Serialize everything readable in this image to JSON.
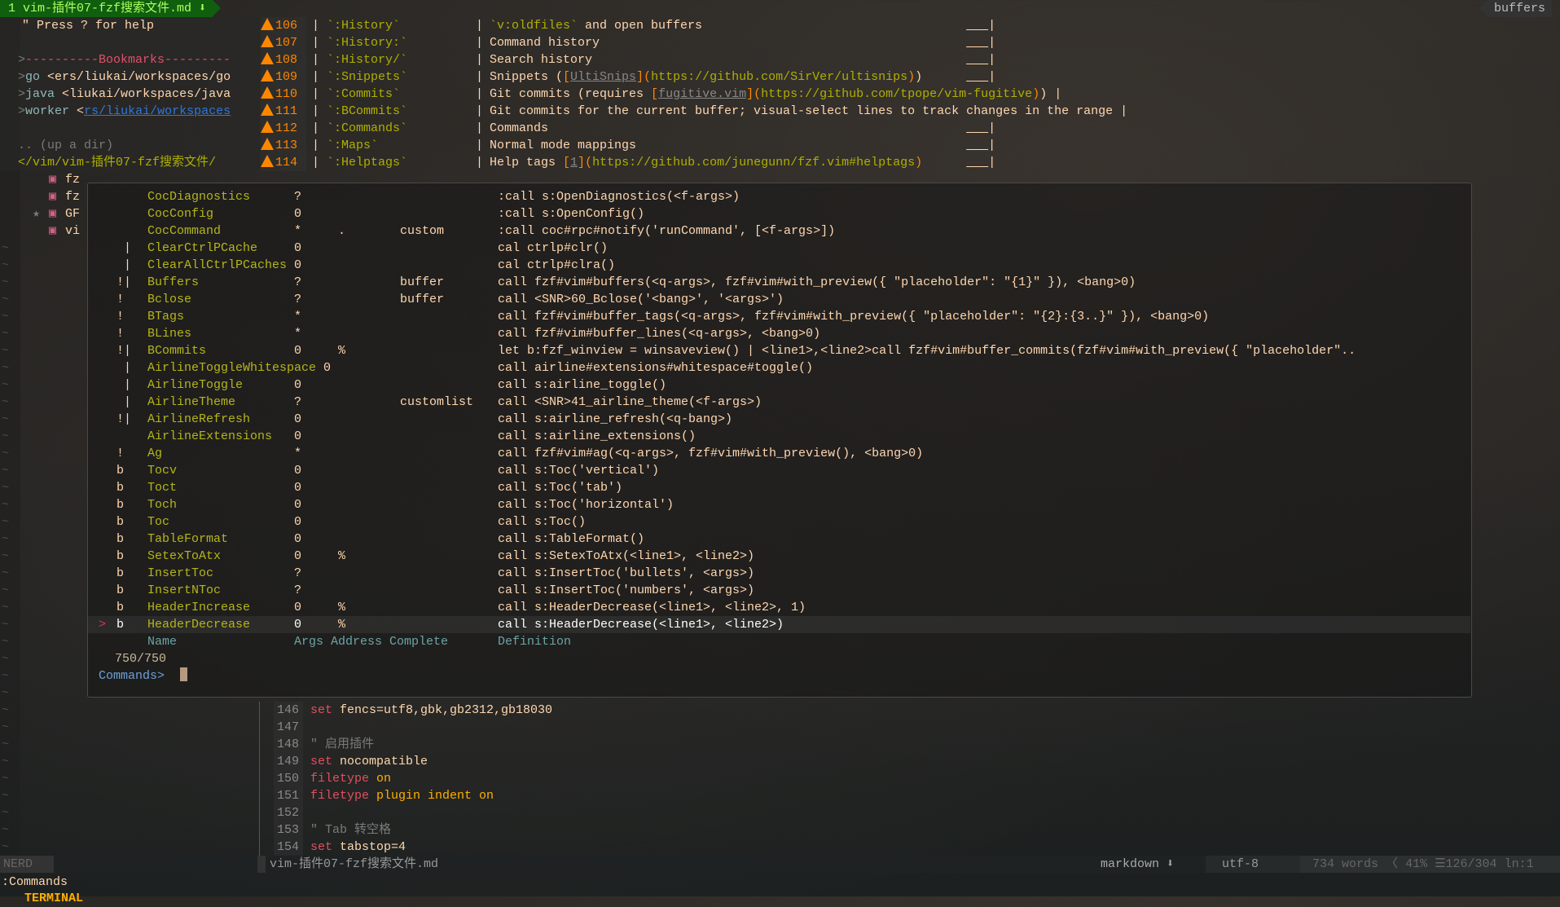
{
  "tabline": {
    "active_tab": "1 vim-插件07-fzf搜索文件.md",
    "active_icon": "⬇",
    "buffers_label": "buffers"
  },
  "colors": {
    "accent_green": "#0f5f0f",
    "warning": "#ff8700",
    "name": "#b5b51a",
    "text": "#ffd7af",
    "header": "#6aa5a5",
    "prompt": "#6ea0d8"
  },
  "nerdtree": {
    "help": "\" Press ? for help",
    "bookmarks_prefix": ">",
    "bookmarks_header": "----------Bookmarks---------",
    "bookmarks": [
      {
        "name": "go",
        "path": "<ers/liukai/workspaces/go",
        "link": ""
      },
      {
        "name": "java",
        "path": "<liukai/workspaces/java",
        "link": ""
      },
      {
        "name": "worker",
        "path": "<",
        "link": "rs/liukai/workspaces"
      }
    ],
    "up_dir": ".. (up a dir)",
    "cwd": "</vim/vim-插件07-fzf搜索文件/",
    "files": [
      {
        "name": "fz",
        "starred": false
      },
      {
        "name": "fz",
        "starred": false
      },
      {
        "name": "GF",
        "starred": true
      },
      {
        "name": "vi",
        "starred": false
      }
    ],
    "star": "★"
  },
  "doc_lines": [
    {
      "num": "106",
      "cmd": "`:History`",
      "desc": [
        {
          "t": "`v:oldfiles`",
          "c": "olive"
        },
        {
          "t": " and open buffers"
        }
      ]
    },
    {
      "num": "107",
      "cmd": "`:History:`",
      "desc": [
        {
          "t": "Command history"
        }
      ]
    },
    {
      "num": "108",
      "cmd": "`:History/`",
      "desc": [
        {
          "t": "Search history"
        }
      ]
    },
    {
      "num": "109",
      "cmd": "`:Snippets`",
      "desc": [
        {
          "t": "Snippets ("
        },
        {
          "t": "[",
          "c": "orange"
        },
        {
          "t": "UltiSnips",
          "c": "ugray"
        },
        {
          "t": "]",
          "c": "orange"
        },
        {
          "t": "(",
          "c": "orange"
        },
        {
          "t": "https://github.com/SirVer/ultisnips",
          "c": "olive"
        },
        {
          "t": ")",
          "c": "orange"
        },
        {
          "t": ")"
        }
      ]
    },
    {
      "num": "110",
      "cmd": "`:Commits`",
      "desc": [
        {
          "t": "Git commits (requires "
        },
        {
          "t": "[",
          "c": "orange"
        },
        {
          "t": "fugitive.vim",
          "c": "ugray"
        },
        {
          "t": "]",
          "c": "orange"
        },
        {
          "t": "(",
          "c": "orange"
        },
        {
          "t": "https://github.com/tpope/vim-fugitive",
          "c": "olive"
        },
        {
          "t": ")",
          "c": "orange"
        },
        {
          "t": ")"
        }
      ]
    },
    {
      "num": "111",
      "cmd": "`:BCommits`",
      "desc": [
        {
          "t": "Git commits for the current buffer; visual-select lines to track changes in the range"
        }
      ]
    },
    {
      "num": "112",
      "cmd": "`:Commands`",
      "desc": [
        {
          "t": "Commands"
        }
      ]
    },
    {
      "num": "113",
      "cmd": "`:Maps`",
      "desc": [
        {
          "t": "Normal mode mappings"
        }
      ]
    },
    {
      "num": "114",
      "cmd": "`:Helptags`",
      "desc": [
        {
          "t": "Help tags "
        },
        {
          "t": "[",
          "c": "orange"
        },
        {
          "t": "1",
          "c": "ugray"
        },
        {
          "t": "]",
          "c": "orange"
        },
        {
          "t": "(",
          "c": "orange"
        },
        {
          "t": "https://github.com/junegunn/fzf.vim#helptags",
          "c": "olive"
        },
        {
          "t": ")",
          "c": "orange"
        }
      ]
    }
  ],
  "popup": {
    "rows": [
      {
        "flags": "",
        "name": "CocDiagnostics",
        "args": "?",
        "address": "",
        "complete": "",
        "definition": ":call s:OpenDiagnostics(<f-args>)"
      },
      {
        "flags": "",
        "name": "CocConfig",
        "args": "0",
        "address": "",
        "complete": "",
        "definition": ":call s:OpenConfig()"
      },
      {
        "flags": "",
        "name": "CocCommand",
        "args": "*",
        "address": ".",
        "complete": "custom",
        "definition": ":call coc#rpc#notify('runCommand', [<f-args>])"
      },
      {
        "flags": " |",
        "name": "ClearCtrlPCache",
        "args": "0",
        "address": "",
        "complete": "",
        "definition": "cal ctrlp#clr()"
      },
      {
        "flags": " |",
        "name": "ClearAllCtrlPCaches",
        "args": "0",
        "address": "",
        "complete": "",
        "definition": "cal ctrlp#clra()"
      },
      {
        "flags": "!|",
        "name": "Buffers",
        "args": "?",
        "address": "",
        "complete": "buffer",
        "definition": "call fzf#vim#buffers(<q-args>, fzf#vim#with_preview({ \"placeholder\": \"{1}\" }), <bang>0)"
      },
      {
        "flags": "!",
        "name": "Bclose",
        "args": "?",
        "address": "",
        "complete": "buffer",
        "definition": "call <SNR>60_Bclose('<bang>', '<args>')"
      },
      {
        "flags": "!",
        "name": "BTags",
        "args": "*",
        "address": "",
        "complete": "",
        "definition": "call fzf#vim#buffer_tags(<q-args>, fzf#vim#with_preview({ \"placeholder\": \"{2}:{3..}\" }), <bang>0)"
      },
      {
        "flags": "!",
        "name": "BLines",
        "args": "*",
        "address": "",
        "complete": "",
        "definition": "call fzf#vim#buffer_lines(<q-args>, <bang>0)"
      },
      {
        "flags": "!|",
        "name": "BCommits",
        "args": "0",
        "address": "%",
        "complete": "",
        "definition": "let b:fzf_winview = winsaveview() | <line1>,<line2>call fzf#vim#buffer_commits(fzf#vim#with_preview({ \"placeholder\".."
      },
      {
        "flags": " |",
        "name": "AirlineToggleWhitespace",
        "args": "0",
        "address": "",
        "complete": "",
        "definition": "call airline#extensions#whitespace#toggle()"
      },
      {
        "flags": " |",
        "name": "AirlineToggle",
        "args": "0",
        "address": "",
        "complete": "",
        "definition": "call s:airline_toggle()"
      },
      {
        "flags": " |",
        "name": "AirlineTheme",
        "args": "?",
        "address": "",
        "complete": "customlist",
        "definition": "call <SNR>41_airline_theme(<f-args>)"
      },
      {
        "flags": "!|",
        "name": "AirlineRefresh",
        "args": "0",
        "address": "",
        "complete": "",
        "definition": "call s:airline_refresh(<q-bang>)"
      },
      {
        "flags": "",
        "name": "AirlineExtensions",
        "args": "0",
        "address": "",
        "complete": "",
        "definition": "call s:airline_extensions()"
      },
      {
        "flags": "!",
        "name": "Ag",
        "args": "*",
        "address": "",
        "complete": "",
        "definition": "call fzf#vim#ag(<q-args>, fzf#vim#with_preview(), <bang>0)"
      },
      {
        "flags": "b",
        "name": "Tocv",
        "args": "0",
        "address": "",
        "complete": "",
        "definition": "call s:Toc('vertical')"
      },
      {
        "flags": "b",
        "name": "Toct",
        "args": "0",
        "address": "",
        "complete": "",
        "definition": "call s:Toc('tab')"
      },
      {
        "flags": "b",
        "name": "Toch",
        "args": "0",
        "address": "",
        "complete": "",
        "definition": "call s:Toc('horizontal')"
      },
      {
        "flags": "b",
        "name": "Toc",
        "args": "0",
        "address": "",
        "complete": "",
        "definition": "call s:Toc()"
      },
      {
        "flags": "b",
        "name": "TableFormat",
        "args": "0",
        "address": "",
        "complete": "",
        "definition": "call s:TableFormat()"
      },
      {
        "flags": "b",
        "name": "SetexToAtx",
        "args": "0",
        "address": "%",
        "complete": "",
        "definition": "call s:SetexToAtx(<line1>, <line2>)"
      },
      {
        "flags": "b",
        "name": "InsertToc",
        "args": "?",
        "address": "",
        "complete": "",
        "definition": "call s:InsertToc('bullets', <args>)"
      },
      {
        "flags": "b",
        "name": "InsertNToc",
        "args": "?",
        "address": "",
        "complete": "",
        "definition": "call s:InsertToc('numbers', <args>)"
      },
      {
        "flags": "b",
        "name": "HeaderIncrease",
        "args": "0",
        "address": "%",
        "complete": "",
        "definition": "call s:HeaderDecrease(<line1>, <line2>, 1)"
      },
      {
        "flags": "b",
        "name": "HeaderDecrease",
        "args": "0",
        "address": "%",
        "complete": "",
        "definition": "call s:HeaderDecrease(<line1>, <line2>)",
        "selected": true
      }
    ],
    "pointer": ">",
    "header": {
      "name": "Name",
      "args_address_complete": "Args Address Complete",
      "definition": "Definition"
    },
    "count": "750/750",
    "prompt": "Commands>",
    "query": ""
  },
  "editor": {
    "lines": [
      {
        "num": "146",
        "seg": [
          {
            "t": "set",
            "c": "kw"
          },
          {
            "t": " fencs=utf8,gbk,gb2312,gb18030"
          }
        ]
      },
      {
        "num": "147",
        "seg": []
      },
      {
        "num": "148",
        "seg": [
          {
            "t": "\" 启用插件",
            "c": "gray"
          }
        ]
      },
      {
        "num": "149",
        "seg": [
          {
            "t": "set",
            "c": "kw"
          },
          {
            "t": " nocompatible"
          }
        ]
      },
      {
        "num": "150",
        "seg": [
          {
            "t": "filetype",
            "c": "kw"
          },
          {
            "t": " on",
            "c": "on"
          }
        ]
      },
      {
        "num": "151",
        "seg": [
          {
            "t": "filetype",
            "c": "kw"
          },
          {
            "t": " plugin indent on",
            "c": "on"
          }
        ]
      },
      {
        "num": "152",
        "seg": []
      },
      {
        "num": "153",
        "seg": [
          {
            "t": "\" Tab 转空格",
            "c": "gray"
          }
        ]
      },
      {
        "num": "154",
        "seg": [
          {
            "t": "set",
            "c": "kw"
          },
          {
            "t": " tabstop=4"
          }
        ]
      }
    ]
  },
  "statusline": {
    "nerd": "NERD",
    "filename": "vim-插件07-fzf搜索文件.md",
    "filetype": "markdown",
    "filetype_icon": "⬇",
    "encoding": "utf-8",
    "os_icon": "",
    "words": "734 words",
    "percent": "41%",
    "position": "126/304",
    "column": ":1"
  },
  "cmdline": {
    "text": ":Commands",
    "mode": "TERMINAL"
  }
}
